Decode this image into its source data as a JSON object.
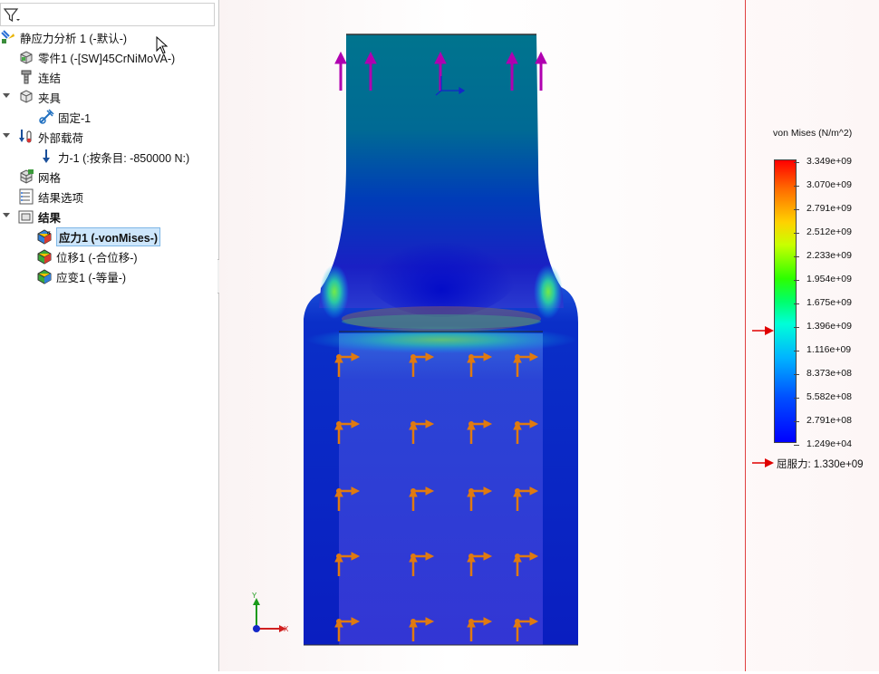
{
  "tree": {
    "study": "静应力分析 1 (-默认-)",
    "part": "零件1 (-[SW]45CrNiMoVA-)",
    "connections": "连结",
    "fixtures": "夹具",
    "fixture_1": "固定-1",
    "external_loads": "外部载荷",
    "force_1": "力-1 (:按条目: -850000 N:)",
    "mesh": "网格",
    "result_options": "结果选项",
    "results": "结果",
    "stress_1": "应力1 (-vonMises-)",
    "displacement_1": "位移1 (-合位移-)",
    "strain_1": "应变1 (-等量-)"
  },
  "legend": {
    "title": "von Mises (N/m^2)",
    "labels": [
      "3.349e+09",
      "3.070e+09",
      "2.791e+09",
      "2.512e+09",
      "2.233e+09",
      "1.954e+09",
      "1.675e+09",
      "1.396e+09",
      "1.116e+09",
      "8.373e+08",
      "5.582e+08",
      "2.791e+08",
      "1.249e+04"
    ],
    "yield_label": "屈服力: 1.330e+09"
  },
  "triad": {
    "y": "Y",
    "x": "X"
  },
  "colors": {
    "selection": "#cde6fb",
    "yield_arrow": "#e00000",
    "load_arrow": "#b000b0",
    "fixture": "#e07a10"
  }
}
